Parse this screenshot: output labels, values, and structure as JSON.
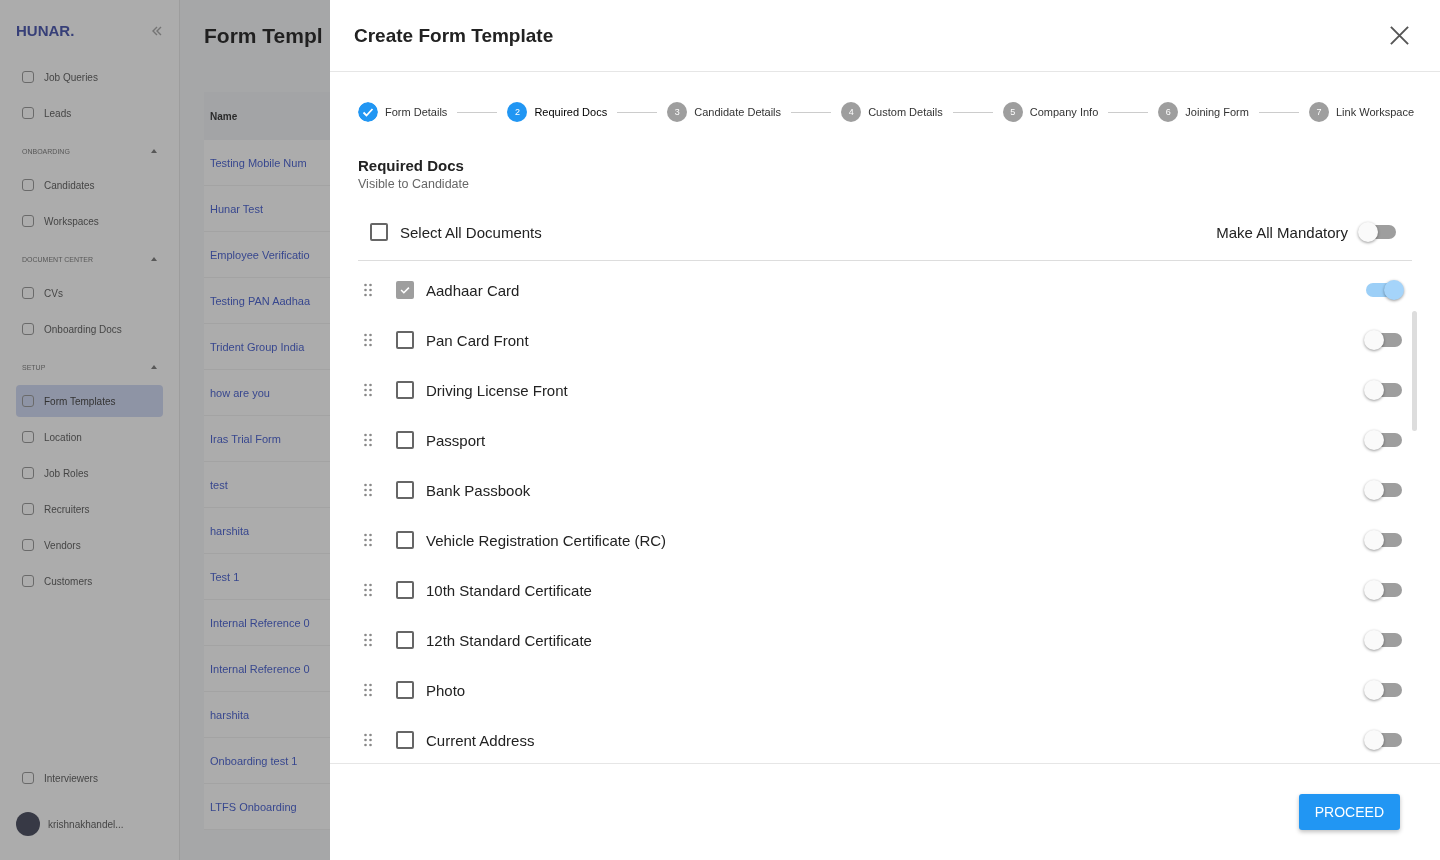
{
  "background": {
    "logo": "HUNAR.",
    "page_title": "Form Templ",
    "sidebar": [
      {
        "kind": "item",
        "label": "Job Queries",
        "selected": false
      },
      {
        "kind": "item",
        "label": "Leads",
        "selected": false
      },
      {
        "kind": "section",
        "label": "ONBOARDING"
      },
      {
        "kind": "item",
        "label": "Candidates",
        "selected": false
      },
      {
        "kind": "item",
        "label": "Workspaces",
        "selected": false
      },
      {
        "kind": "section",
        "label": "DOCUMENT CENTER"
      },
      {
        "kind": "item",
        "label": "CVs",
        "selected": false
      },
      {
        "kind": "item",
        "label": "Onboarding Docs",
        "selected": false
      },
      {
        "kind": "section",
        "label": "SETUP"
      },
      {
        "kind": "item",
        "label": "Form Templates",
        "selected": true
      },
      {
        "kind": "item",
        "label": "Location",
        "selected": false
      },
      {
        "kind": "item",
        "label": "Job Roles",
        "selected": false
      },
      {
        "kind": "item",
        "label": "Recruiters",
        "selected": false
      },
      {
        "kind": "item",
        "label": "Vendors",
        "selected": false
      },
      {
        "kind": "item",
        "label": "Customers",
        "selected": false
      }
    ],
    "footer_item": "Interviewers",
    "user": "krishnakhandel...",
    "table": {
      "columns": [
        "Name"
      ],
      "rows": [
        "Testing Mobile Num",
        "Hunar Test",
        "Employee Verificatio",
        "Testing PAN Aadhaa",
        "Trident Group India",
        "how are you",
        "Iras Trial Form",
        "test",
        "harshita",
        "Test 1",
        "Internal Reference 0",
        "Internal Reference 0",
        "harshita",
        "Onboarding test 1",
        "LTFS Onboarding"
      ]
    }
  },
  "modal": {
    "title": "Create Form Template",
    "steps": [
      {
        "label": "Form Details",
        "done": true,
        "selected": false
      },
      {
        "number": "2",
        "label": "Required Docs",
        "done": false,
        "selected": true
      },
      {
        "number": "3",
        "label": "Candidate Details",
        "done": false,
        "selected": false
      },
      {
        "number": "4",
        "label": "Custom Details",
        "done": false,
        "selected": false
      },
      {
        "number": "5",
        "label": "Company Info",
        "done": false,
        "selected": false
      },
      {
        "number": "6",
        "label": "Joining Form",
        "done": false,
        "selected": false
      },
      {
        "number": "7",
        "label": "Link Workspace",
        "done": false,
        "selected": false
      }
    ],
    "section_title": "Required Docs",
    "section_subtitle": "Visible to Candidate",
    "select_all": {
      "label": "Select All Documents",
      "checked": false
    },
    "make_all_mandatory": {
      "label": "Make All Mandatory",
      "on": false
    },
    "documents": [
      {
        "name": "Aadhaar Card",
        "checked": true,
        "mandatory": true
      },
      {
        "name": "Pan Card Front",
        "checked": false,
        "mandatory": false
      },
      {
        "name": "Driving License Front",
        "checked": false,
        "mandatory": false
      },
      {
        "name": "Passport",
        "checked": false,
        "mandatory": false
      },
      {
        "name": "Bank Passbook",
        "checked": false,
        "mandatory": false
      },
      {
        "name": "Vehicle Registration Certificate (RC)",
        "checked": false,
        "mandatory": false
      },
      {
        "name": "10th Standard Certificate",
        "checked": false,
        "mandatory": false
      },
      {
        "name": "12th Standard Certificate",
        "checked": false,
        "mandatory": false
      },
      {
        "name": "Photo",
        "checked": false,
        "mandatory": false
      },
      {
        "name": "Current Address",
        "checked": false,
        "mandatory": false
      }
    ],
    "proceed_button": "PROCEED"
  }
}
